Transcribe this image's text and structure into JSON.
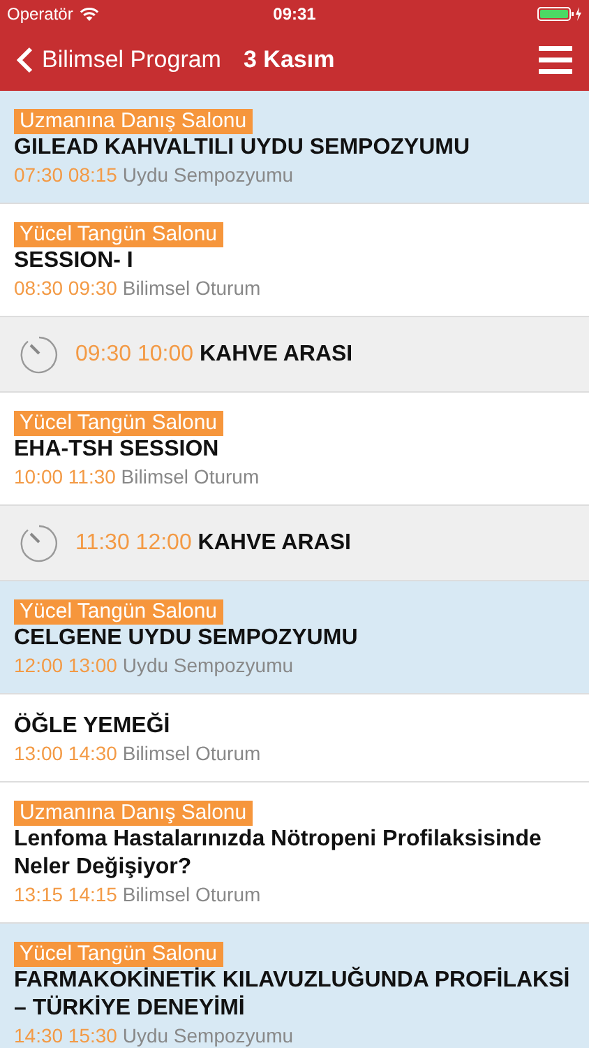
{
  "status_bar": {
    "carrier": "Operatör",
    "time": "09:31"
  },
  "nav": {
    "back_label": "Bilimsel Program",
    "title": "3 Kasım"
  },
  "rows": [
    {
      "kind": "session",
      "highlighted": true,
      "hall": "Uzmanına Danış Salonu",
      "title": "GILEAD KAHVALTILI UYDU SEMPOZYUMU",
      "start": "07:30",
      "end": "08:15",
      "type": "Uydu Sempozyumu"
    },
    {
      "kind": "session",
      "highlighted": false,
      "hall": "Yücel Tangün Salonu",
      "title": "SESSION- I",
      "start": "08:30",
      "end": "09:30",
      "type": "Bilimsel Oturum"
    },
    {
      "kind": "break",
      "start": "09:30",
      "end": "10:00",
      "title": "KAHVE ARASI"
    },
    {
      "kind": "session",
      "highlighted": false,
      "hall": "Yücel Tangün Salonu",
      "title": "EHA-TSH SESSION",
      "start": "10:00",
      "end": "11:30",
      "type": "Bilimsel Oturum"
    },
    {
      "kind": "break",
      "start": "11:30",
      "end": "12:00",
      "title": "KAHVE ARASI"
    },
    {
      "kind": "session",
      "highlighted": true,
      "hall": "Yücel Tangün Salonu",
      "title": "CELGENE UYDU SEMPOZYUMU",
      "start": "12:00",
      "end": "13:00",
      "type": "Uydu Sempozyumu"
    },
    {
      "kind": "session",
      "highlighted": false,
      "title": "ÖĞLE YEMEĞİ",
      "start": "13:00",
      "end": "14:30",
      "type": "Bilimsel Oturum"
    },
    {
      "kind": "session",
      "highlighted": false,
      "hall": "Uzmanına Danış Salonu",
      "title": "Lenfoma Hastalarınızda Nötropeni Profilaksisinde Neler Değişiyor?",
      "start": "13:15",
      "end": "14:15",
      "type": "Bilimsel Oturum"
    },
    {
      "kind": "session",
      "highlighted": true,
      "hall": "Yücel Tangün Salonu",
      "title": "FARMAKOKİNETİK KILAVUZLUĞUNDA PROFİLAKSİ – TÜRKİYE DENEYİMİ",
      "start": "14:30",
      "end": "15:30",
      "type": "Uydu Sempozyumu"
    }
  ]
}
